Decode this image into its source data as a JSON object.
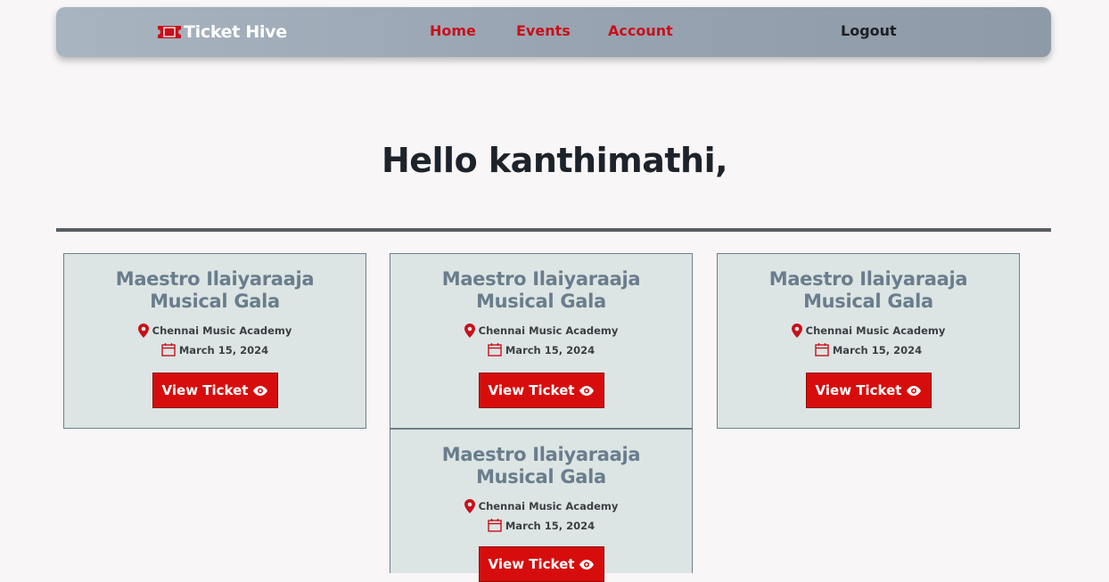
{
  "nav": {
    "brand": "Ticket Hive",
    "brand_icon": "ticket-icon",
    "links": [
      "Home",
      "Events",
      "Account"
    ],
    "logout": "Logout",
    "accent_color": "#c8101a"
  },
  "greeting": "Hello kanthimathi,",
  "tickets": [
    {
      "title": "Maestro Ilaiyaraaja Musical Gala",
      "venue": "Chennai Music Academy",
      "date": "March 15, 2024",
      "button": "View Ticket"
    },
    {
      "title": "Maestro Ilaiyaraaja Musical Gala",
      "venue": "Chennai Music Academy",
      "date": "March 15, 2024",
      "button": "View Ticket"
    },
    {
      "title": "Maestro Ilaiyaraaja Musical Gala",
      "venue": "Chennai Music Academy",
      "date": "March 15, 2024",
      "button": "View Ticket"
    },
    {
      "title": "Maestro Ilaiyaraaja Musical Gala",
      "venue": "Chennai Music Academy",
      "date": "March 15, 2024",
      "button": "View Ticket"
    }
  ],
  "icons": {
    "venue": "map-pin-icon",
    "date": "calendar-icon",
    "button": "eye-icon"
  },
  "colors": {
    "button_bg": "#d70d0d",
    "card_bg": "#dce5e3",
    "title": "#6a7d8d"
  }
}
